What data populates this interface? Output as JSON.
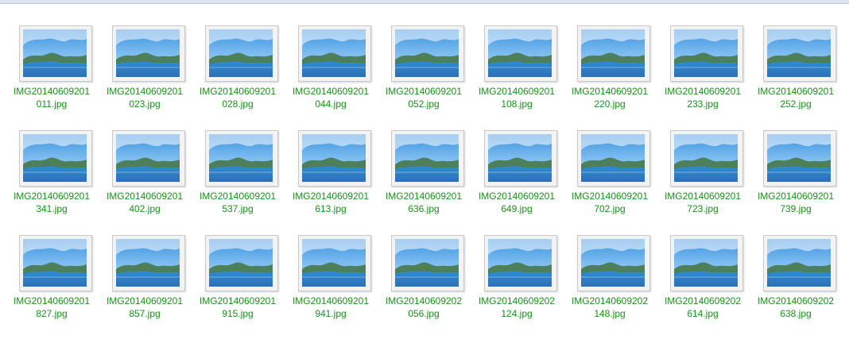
{
  "window": {
    "title": ""
  },
  "files": [
    [
      "IMG20140609201",
      "011.jpg"
    ],
    [
      "IMG20140609201",
      "023.jpg"
    ],
    [
      "IMG20140609201",
      "028.jpg"
    ],
    [
      "IMG20140609201",
      "044.jpg"
    ],
    [
      "IMG20140609201",
      "052.jpg"
    ],
    [
      "IMG20140609201",
      "108.jpg"
    ],
    [
      "IMG20140609201",
      "220.jpg"
    ],
    [
      "IMG20140609201",
      "233.jpg"
    ],
    [
      "IMG20140609201",
      "252.jpg"
    ],
    [
      "IMG20140609201",
      "341.jpg"
    ],
    [
      "IMG20140609201",
      "402.jpg"
    ],
    [
      "IMG20140609201",
      "537.jpg"
    ],
    [
      "IMG20140609201",
      "613.jpg"
    ],
    [
      "IMG20140609201",
      "636.jpg"
    ],
    [
      "IMG20140609201",
      "649.jpg"
    ],
    [
      "IMG20140609201",
      "702.jpg"
    ],
    [
      "IMG20140609201",
      "723.jpg"
    ],
    [
      "IMG20140609201",
      "739.jpg"
    ],
    [
      "IMG20140609201",
      "827.jpg"
    ],
    [
      "IMG20140609201",
      "857.jpg"
    ],
    [
      "IMG20140609201",
      "915.jpg"
    ],
    [
      "IMG20140609201",
      "941.jpg"
    ],
    [
      "IMG20140609202",
      "056.jpg"
    ],
    [
      "IMG20140609202",
      "124.jpg"
    ],
    [
      "IMG20140609202",
      "148.jpg"
    ],
    [
      "IMG20140609202",
      "614.jpg"
    ],
    [
      "IMG20140609202",
      "638.jpg"
    ]
  ],
  "colors": {
    "label_green": "#1a8f1a",
    "sky_top": "#3a93e0",
    "sky_bottom": "#bfe4ff",
    "water": "#2f6fb3"
  },
  "icon_name": "image-thumbnail-icon"
}
